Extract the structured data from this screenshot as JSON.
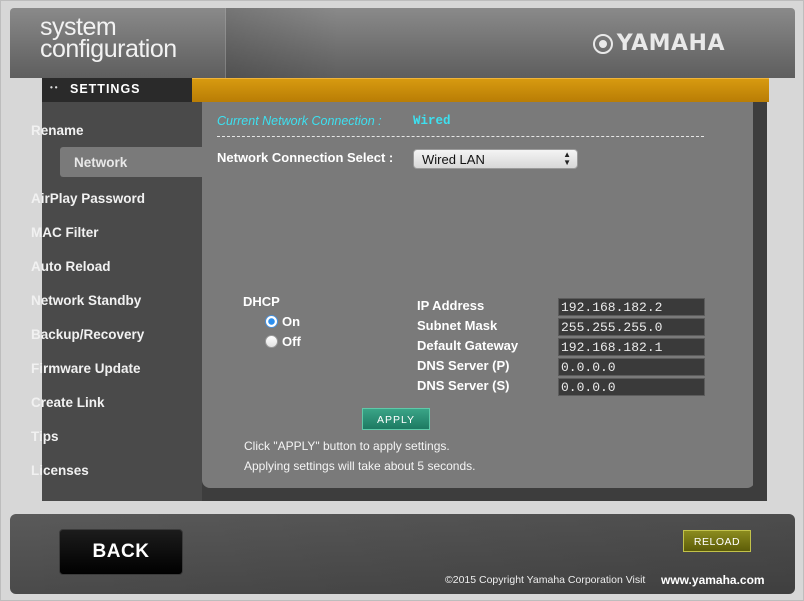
{
  "header": {
    "title_line1": "system",
    "title_line2": "configuration",
    "brand": "YAMAHA"
  },
  "section": {
    "label": "SETTINGS"
  },
  "sidebar": {
    "items": [
      {
        "label": "Rename"
      },
      {
        "label": "Network",
        "active": true
      },
      {
        "label": "AirPlay Password"
      },
      {
        "label": "MAC Filter"
      },
      {
        "label": "Auto Reload"
      },
      {
        "label": "Network Standby"
      },
      {
        "label": "Backup/Recovery"
      },
      {
        "label": "Firmware Update"
      },
      {
        "label": "Create Link"
      },
      {
        "label": "Tips"
      },
      {
        "label": "Licenses"
      }
    ]
  },
  "network": {
    "current_label": "Current Network Connection :",
    "current_value": "Wired",
    "select_label": "Network Connection Select :",
    "select_value": "Wired LAN",
    "dhcp_label": "DHCP",
    "dhcp_on": "On",
    "dhcp_off": "Off",
    "dhcp_selected": "On",
    "fields": [
      {
        "label": "IP Address",
        "value": "192.168.182.2"
      },
      {
        "label": "Subnet Mask",
        "value": "255.255.255.0"
      },
      {
        "label": "Default Gateway",
        "value": "192.168.182.1"
      },
      {
        "label": "DNS Server (P)",
        "value": "0.0.0.0"
      },
      {
        "label": "DNS Server (S)",
        "value": "0.0.0.0"
      }
    ],
    "apply_label": "APPLY",
    "help_line1": "Click \"APPLY\" button to apply settings.",
    "help_line2": "Applying settings will take about 5 seconds."
  },
  "footer": {
    "back_label": "BACK",
    "reload_label": "RELOAD",
    "copyright": "©2015 Copyright Yamaha Corporation Visit",
    "site": "www.yamaha.com"
  },
  "colors": {
    "accent_orange": "#c88a0a",
    "connection_text": "#3de0f0",
    "apply_green": "#1d7a62",
    "reload_olive": "#6e6e12"
  }
}
